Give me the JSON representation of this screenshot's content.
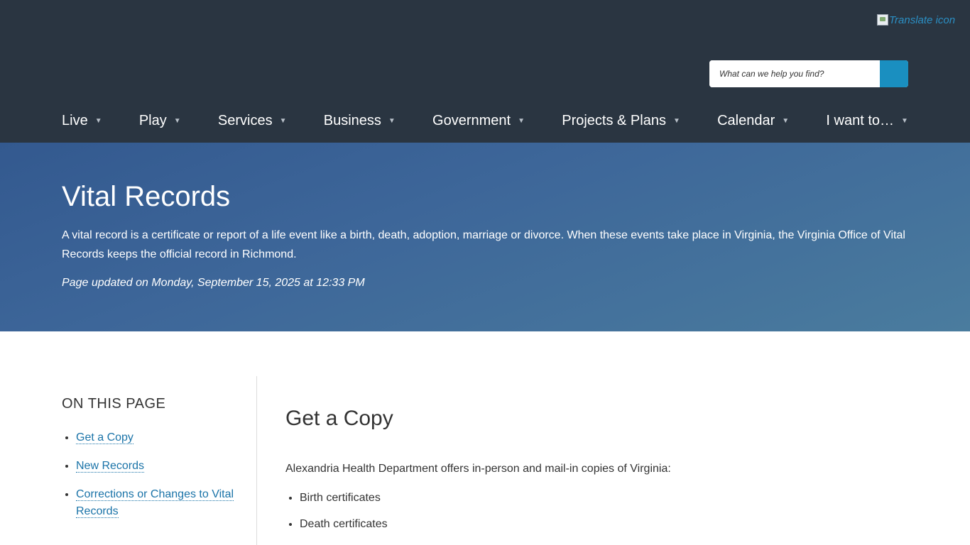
{
  "header": {
    "translate_alt": "Translate icon",
    "search": {
      "placeholder": "What can we help you find?"
    },
    "nav": [
      {
        "label": "Live",
        "caret": "▼"
      },
      {
        "label": "Play",
        "caret": "▼"
      },
      {
        "label": "Services",
        "caret": "▼"
      },
      {
        "label": "Business",
        "caret": "▼"
      },
      {
        "label": "Government",
        "caret": "▼"
      },
      {
        "label": "Projects & Plans",
        "caret": "▼"
      },
      {
        "label": "Calendar",
        "caret": "▼"
      },
      {
        "label": "I want to…",
        "caret": "▼"
      }
    ]
  },
  "hero": {
    "title": "Vital Records",
    "intro": "A vital record is a certificate or report of a life event like a birth, death, adoption, marriage or divorce. When these events take place in Virginia, the Virginia Office of Vital Records keeps the official record in Richmond.",
    "updated": "Page updated on Monday, September 15, 2025 at 12:33 PM"
  },
  "sidebar": {
    "heading": "ON THIS PAGE",
    "links": [
      {
        "label": "Get a Copy"
      },
      {
        "label": "New Records"
      },
      {
        "label": "Corrections or Changes to Vital Records"
      }
    ]
  },
  "main": {
    "section_title": "Get a Copy",
    "intro": "Alexandria Health Department offers in-person and mail-in copies of Virginia:",
    "items": [
      "Birth certificates",
      "Death certificates"
    ]
  },
  "colors": {
    "header_bg": "#2a3541",
    "hero_bg_start": "#33598f",
    "hero_bg_end": "#4a7c9e",
    "search_button": "#1a8fc0",
    "link": "#1a73a8"
  },
  "icons": {
    "translate": "translate-icon",
    "search": "search-icon",
    "caret": "caret-down-icon"
  }
}
